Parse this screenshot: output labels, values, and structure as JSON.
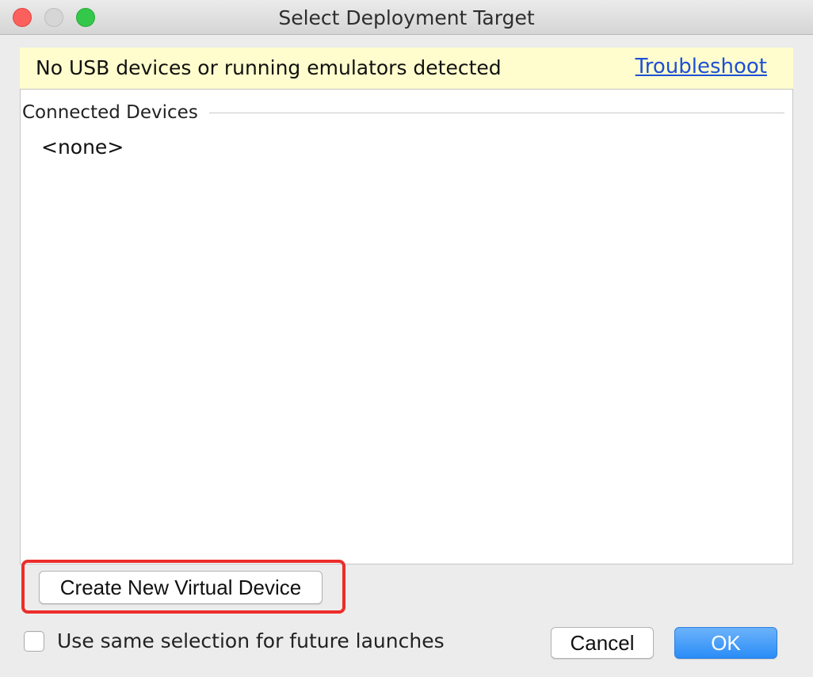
{
  "window": {
    "title": "Select Deployment Target"
  },
  "banner": {
    "message": "No USB devices or running emulators detected",
    "link_label": "Troubleshoot",
    "background_color": "#fffdcd",
    "link_color": "#1d4fd8"
  },
  "devices": {
    "section_label": "Connected Devices",
    "empty_label": "<none>"
  },
  "actions": {
    "create_virtual_device_label": "Create New Virtual Device",
    "highlight_color": "#ec2d2a"
  },
  "footer": {
    "checkbox_label": "Use same selection for future launches",
    "checkbox_checked": false,
    "cancel_label": "Cancel",
    "ok_label": "OK",
    "ok_color": "#2a8cf7"
  },
  "icons": {
    "close": "close-icon",
    "minimize": "minimize-icon",
    "zoom": "zoom-icon"
  }
}
